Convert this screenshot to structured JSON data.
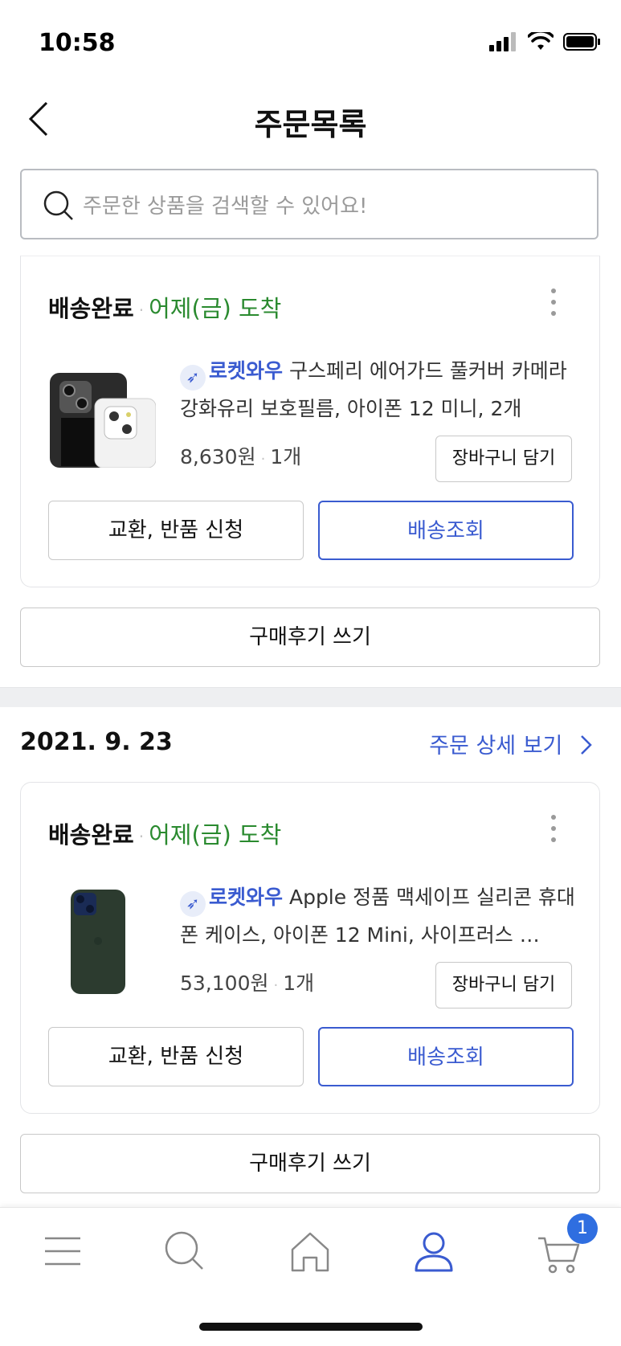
{
  "status_bar": {
    "time": "10:58"
  },
  "header": {
    "title": "주문목록"
  },
  "search": {
    "placeholder": "주문한 상품을 검색할 수 있어요!"
  },
  "orders": [
    {
      "status": "배송완료",
      "arrival": "어제(금) 도착",
      "badge": "로켓와우",
      "product_name": "구스페리 에어가드 풀커버 카메라 강화유리 보호필름, 아이폰 12 미니, 2개",
      "price": "8,630원",
      "quantity": "1개",
      "cart_label": "장바구니 담기",
      "exchange_label": "교환, 반품 신청",
      "track_label": "배송조회",
      "review_label": "구매후기 쓰기"
    },
    {
      "date": "2021. 9. 23",
      "detail_link": "주문 상세 보기",
      "status": "배송완료",
      "arrival": "어제(금) 도착",
      "badge": "로켓와우",
      "product_name": "Apple 정품 맥세이프 실리콘 휴대폰 케이스, 아이폰 12 Mini, 사이프러스 …",
      "price": "53,100원",
      "quantity": "1개",
      "cart_label": "장바구니 담기",
      "exchange_label": "교환, 반품 신청",
      "track_label": "배송조회",
      "review_label": "구매후기 쓰기"
    }
  ],
  "tab_bar": {
    "cart_badge": "1",
    "active_tab": "my-page",
    "icons": [
      "menu-icon",
      "search-icon",
      "home-icon",
      "person-icon",
      "cart-icon"
    ]
  },
  "colors": {
    "accent": "#3a5bd0",
    "arrival_green": "#2a8a2f",
    "badge_blue": "#2f6ee0"
  }
}
